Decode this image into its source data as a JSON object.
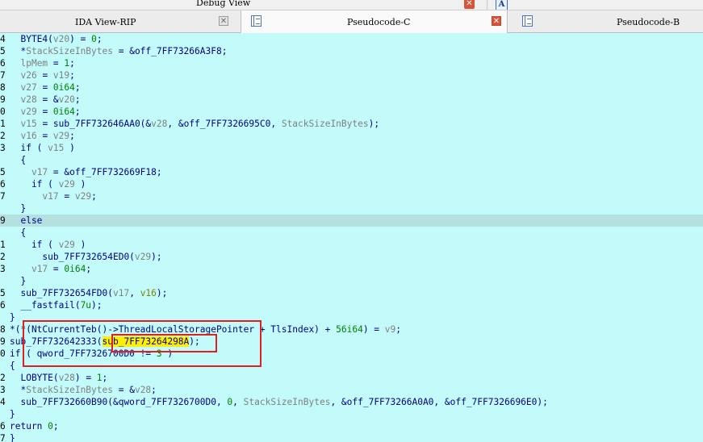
{
  "top_panel": {
    "title": "Debug View",
    "a_icon_label": "A",
    "close_glyph": "✕"
  },
  "tabs": [
    {
      "label": "IDA View-RIP",
      "close_glyph": "✕"
    },
    {
      "label": "Pseudocode-C",
      "close_glyph": "✕"
    },
    {
      "label": "Pseudocode-B"
    }
  ],
  "colors": {
    "background": "#c3fbfb",
    "highlight_line": "#b4e0e0",
    "code_text": "#000080",
    "variable": "#808080",
    "number": "#008000",
    "highlight_mark": "#fff000",
    "annotation_box": "#e02020"
  },
  "code_lines": [
    {
      "num": "4",
      "tokens": [
        [
          "t",
          "  BYTE4("
        ],
        [
          "v",
          "v20"
        ],
        [
          "t",
          ") = "
        ],
        [
          "n",
          "0"
        ],
        [
          "t",
          ";"
        ]
      ]
    },
    {
      "num": "5",
      "tokens": [
        [
          "t",
          "  *"
        ],
        [
          "v",
          "StackSizeInBytes"
        ],
        [
          "t",
          " = &off_7FF73266A3F8;"
        ]
      ]
    },
    {
      "num": "6",
      "tokens": [
        [
          "t",
          "  "
        ],
        [
          "v",
          "lpMem"
        ],
        [
          "t",
          " = "
        ],
        [
          "n",
          "1"
        ],
        [
          "t",
          ";"
        ]
      ]
    },
    {
      "num": "7",
      "tokens": [
        [
          "t",
          "  "
        ],
        [
          "v",
          "v26"
        ],
        [
          "t",
          " = "
        ],
        [
          "v",
          "v19"
        ],
        [
          "t",
          ";"
        ]
      ]
    },
    {
      "num": "8",
      "tokens": [
        [
          "t",
          "  "
        ],
        [
          "v",
          "v27"
        ],
        [
          "t",
          " = "
        ],
        [
          "n",
          "0i64"
        ],
        [
          "t",
          ";"
        ]
      ]
    },
    {
      "num": "9",
      "tokens": [
        [
          "t",
          "  "
        ],
        [
          "v",
          "v28"
        ],
        [
          "t",
          " = &"
        ],
        [
          "v",
          "v20"
        ],
        [
          "t",
          ";"
        ]
      ]
    },
    {
      "num": "0",
      "tokens": [
        [
          "t",
          "  "
        ],
        [
          "v",
          "v29"
        ],
        [
          "t",
          " = "
        ],
        [
          "n",
          "0i64"
        ],
        [
          "t",
          ";"
        ]
      ]
    },
    {
      "num": "1",
      "tokens": [
        [
          "t",
          "  "
        ],
        [
          "v",
          "v15"
        ],
        [
          "t",
          " = sub_7FF732646AA0(&"
        ],
        [
          "v",
          "v28"
        ],
        [
          "t",
          ", &off_7FF7326695C0, "
        ],
        [
          "v",
          "StackSizeInBytes"
        ],
        [
          "t",
          ");"
        ]
      ]
    },
    {
      "num": "2",
      "tokens": [
        [
          "t",
          "  "
        ],
        [
          "v",
          "v16"
        ],
        [
          "t",
          " = "
        ],
        [
          "v",
          "v29"
        ],
        [
          "t",
          ";"
        ]
      ]
    },
    {
      "num": "3",
      "tokens": [
        [
          "t",
          "  if ( "
        ],
        [
          "v",
          "v15"
        ],
        [
          "t",
          " )"
        ]
      ]
    },
    {
      "num": "",
      "tokens": [
        [
          "t",
          "  {"
        ]
      ]
    },
    {
      "num": "5",
      "tokens": [
        [
          "t",
          "    "
        ],
        [
          "v",
          "v17"
        ],
        [
          "t",
          " = &off_7FF732669F18;"
        ]
      ]
    },
    {
      "num": "6",
      "tokens": [
        [
          "t",
          "    if ( "
        ],
        [
          "v",
          "v29"
        ],
        [
          "t",
          " )"
        ]
      ]
    },
    {
      "num": "7",
      "tokens": [
        [
          "t",
          "      "
        ],
        [
          "v",
          "v17"
        ],
        [
          "t",
          " = "
        ],
        [
          "v",
          "v29"
        ],
        [
          "t",
          ";"
        ]
      ]
    },
    {
      "num": "",
      "tokens": [
        [
          "t",
          "  }"
        ]
      ]
    },
    {
      "num": "9",
      "hl": true,
      "tokens": [
        [
          "t",
          "  else"
        ]
      ]
    },
    {
      "num": "",
      "tokens": [
        [
          "t",
          "  {"
        ]
      ]
    },
    {
      "num": "1",
      "tokens": [
        [
          "t",
          "    if ( "
        ],
        [
          "v",
          "v29"
        ],
        [
          "t",
          " )"
        ]
      ]
    },
    {
      "num": "2",
      "tokens": [
        [
          "t",
          "      sub_7FF732654ED0("
        ],
        [
          "v",
          "v29"
        ],
        [
          "t",
          ");"
        ]
      ]
    },
    {
      "num": "3",
      "tokens": [
        [
          "t",
          "    "
        ],
        [
          "v",
          "v17"
        ],
        [
          "t",
          " = "
        ],
        [
          "n",
          "0i64"
        ],
        [
          "t",
          ";"
        ]
      ]
    },
    {
      "num": "",
      "tokens": [
        [
          "t",
          "  }"
        ]
      ]
    },
    {
      "num": "5",
      "tokens": [
        [
          "t",
          "  sub_7FF732654FD0("
        ],
        [
          "v",
          "v17"
        ],
        [
          "t",
          ", "
        ],
        [
          "o",
          "v16"
        ],
        [
          "t",
          ");"
        ]
      ]
    },
    {
      "num": "6",
      "tokens": [
        [
          "t",
          "  __fastfail("
        ],
        [
          "n",
          "7u"
        ],
        [
          "t",
          ");"
        ]
      ]
    },
    {
      "num": "",
      "tokens": [
        [
          "t",
          "}"
        ]
      ]
    },
    {
      "num": "8",
      "tokens": [
        [
          "t",
          "*(*(NtCurrentTeb()->ThreadLocalStoragePointer + TlsIndex) + "
        ],
        [
          "n",
          "56i64"
        ],
        [
          "t",
          ") = "
        ],
        [
          "v",
          "v9"
        ],
        [
          "t",
          ";"
        ]
      ]
    },
    {
      "num": "9",
      "tokens": [
        [
          "t",
          "sub_7FF732642333("
        ],
        [
          "m",
          "sub_7FF73264298A"
        ],
        [
          "t",
          ");"
        ]
      ]
    },
    {
      "num": "0",
      "tokens": [
        [
          "t",
          "if ( qword_7FF7326700D0 != "
        ],
        [
          "n",
          "3"
        ],
        [
          "t",
          " )"
        ]
      ]
    },
    {
      "num": "",
      "tokens": [
        [
          "t",
          "{"
        ]
      ]
    },
    {
      "num": "2",
      "tokens": [
        [
          "t",
          "  LOBYTE("
        ],
        [
          "v",
          "v28"
        ],
        [
          "t",
          ") = "
        ],
        [
          "n",
          "1"
        ],
        [
          "t",
          ";"
        ]
      ]
    },
    {
      "num": "3",
      "tokens": [
        [
          "t",
          "  *"
        ],
        [
          "v",
          "StackSizeInBytes"
        ],
        [
          "t",
          " = &"
        ],
        [
          "v",
          "v28"
        ],
        [
          "t",
          ";"
        ]
      ]
    },
    {
      "num": "4",
      "tokens": [
        [
          "t",
          "  sub_7FF732660B90(&qword_7FF7326700D0, "
        ],
        [
          "n",
          "0"
        ],
        [
          "t",
          ", "
        ],
        [
          "v",
          "StackSizeInBytes"
        ],
        [
          "t",
          ", &off_7FF73266A0A0, &off_7FF7326696E0);"
        ]
      ]
    },
    {
      "num": "",
      "tokens": [
        [
          "t",
          "}"
        ]
      ]
    },
    {
      "num": "6",
      "tokens": [
        [
          "t",
          "return "
        ],
        [
          "n",
          "0"
        ],
        [
          "t",
          ";"
        ]
      ]
    },
    {
      "num": "7",
      "tokens": [
        [
          "t",
          "}"
        ]
      ]
    }
  ]
}
